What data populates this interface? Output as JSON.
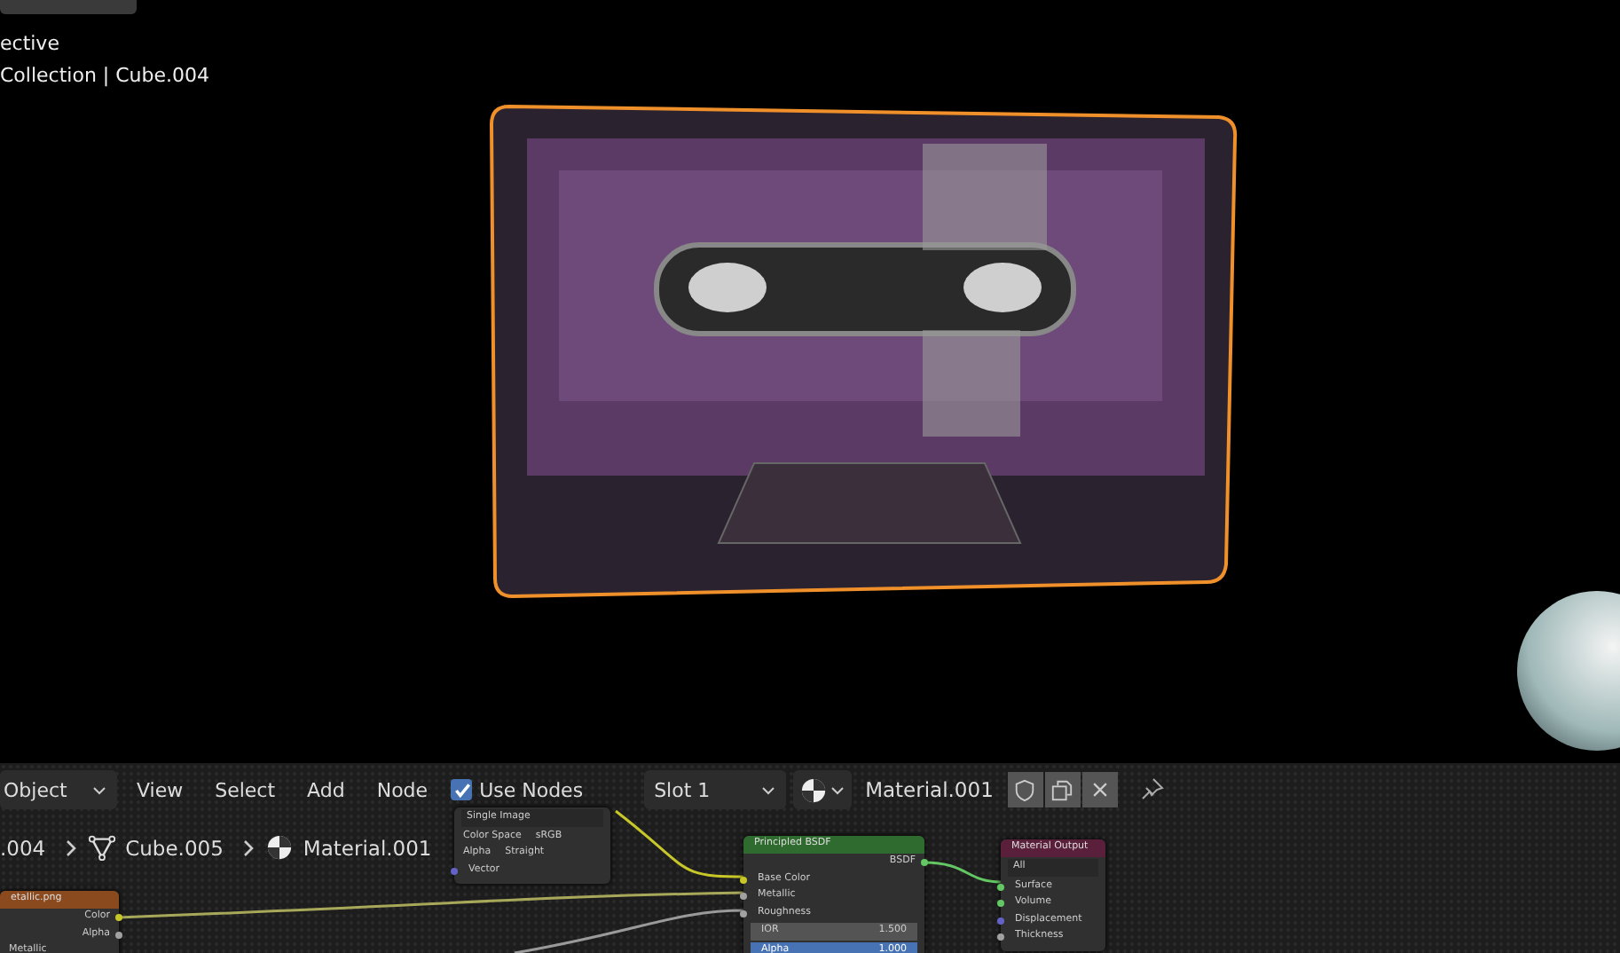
{
  "viewport": {
    "mode_text": "ective",
    "context_text": "Collection | Cube.004"
  },
  "node_editor": {
    "header": {
      "editor_type": "Object",
      "menus": [
        "View",
        "Select",
        "Add",
        "Node"
      ],
      "use_nodes": {
        "label": "Use Nodes",
        "checked": true
      },
      "slot": "Slot 1",
      "material": "Material.001"
    },
    "breadcrumbs": [
      {
        "kind": "text",
        "text": ".004"
      },
      {
        "kind": "mesh",
        "text": "Cube.005"
      },
      {
        "kind": "material",
        "text": "Material.001"
      }
    ],
    "nodes": [
      {
        "title": "etallic.png",
        "color": "#8a4a1e",
        "rows": [
          {
            "kind": "output",
            "label": "Color",
            "color": "#c7c729"
          },
          {
            "kind": "output",
            "label": "Alpha",
            "color": "#a1a1a1"
          },
          {
            "kind": "plain",
            "label": "Metallic"
          }
        ]
      },
      {
        "rows": [
          {
            "kind": "dropdown",
            "label": "Single Image"
          },
          {
            "kind": "pair",
            "label": "Color Space",
            "value": "sRGB"
          },
          {
            "kind": "pair",
            "label": "Alpha",
            "value": "Straight"
          },
          {
            "kind": "input",
            "label": "Vector",
            "color": "#6363c7"
          }
        ]
      },
      {
        "title": "Principled BSDF",
        "color": "#2f6b2f",
        "rows": [
          {
            "kind": "output",
            "label": "BSDF",
            "color": "#63c763"
          },
          {
            "kind": "input",
            "label": "Base Color",
            "color": "#c7c729"
          },
          {
            "kind": "input",
            "label": "Metallic",
            "color": "#a1a1a1"
          },
          {
            "kind": "input",
            "label": "Roughness",
            "color": "#a1a1a1"
          },
          {
            "kind": "field",
            "label": "IOR",
            "value": "1.500",
            "selected": false
          },
          {
            "kind": "field",
            "label": "Alpha",
            "value": "1.000",
            "selected": true
          }
        ]
      },
      {
        "title": "Material Output",
        "color": "#5a1f3a",
        "rows": [
          {
            "kind": "dropdown",
            "label": "All"
          },
          {
            "kind": "input",
            "label": "Surface",
            "color": "#63c763"
          },
          {
            "kind": "input",
            "label": "Volume",
            "color": "#63c763"
          },
          {
            "kind": "input",
            "label": "Displacement",
            "color": "#6363c7"
          },
          {
            "kind": "input",
            "label": "Thickness",
            "color": "#a1a1a1"
          }
        ]
      }
    ]
  }
}
